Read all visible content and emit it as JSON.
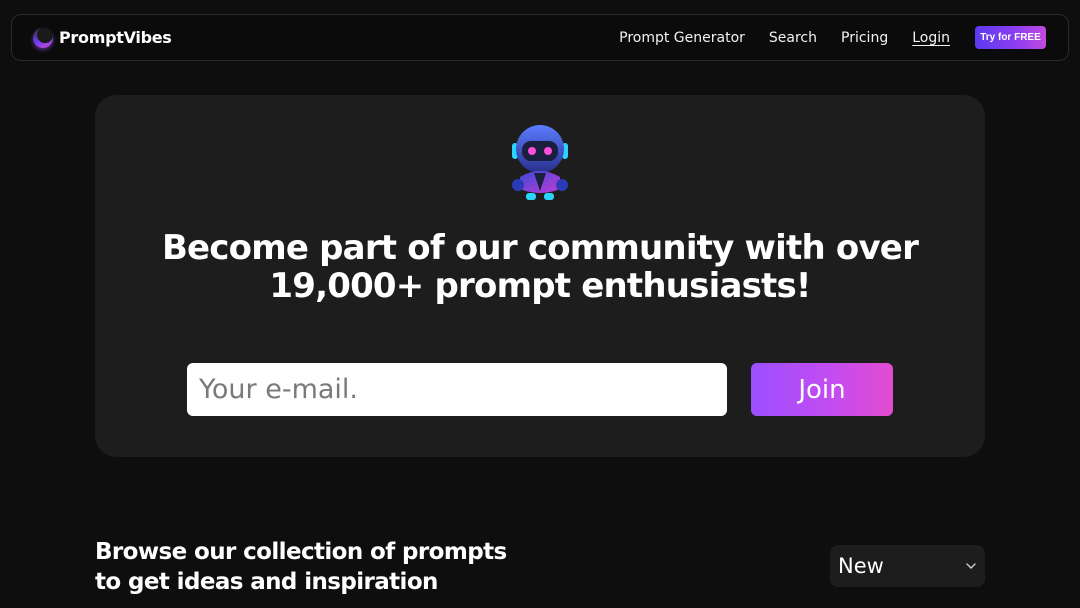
{
  "nav": {
    "brand": "PromptVibes",
    "links": [
      "Prompt Generator",
      "Search",
      "Pricing",
      "Login"
    ],
    "cta": "Try for FREE"
  },
  "hero": {
    "title_line1": "Become part of our community with over",
    "title_line2": "19,000+ prompt enthusiasts!",
    "email_placeholder": "Your e-mail.",
    "join_label": "Join"
  },
  "browse": {
    "title_line1": "Browse our collection of prompts",
    "title_line2": "to get ideas and inspiration",
    "sort_value": "New"
  },
  "colors": {
    "background": "#0e0e0e",
    "card": "#1d1d1d",
    "accent_start": "#9d4fff",
    "accent_end": "#e24ccf"
  }
}
